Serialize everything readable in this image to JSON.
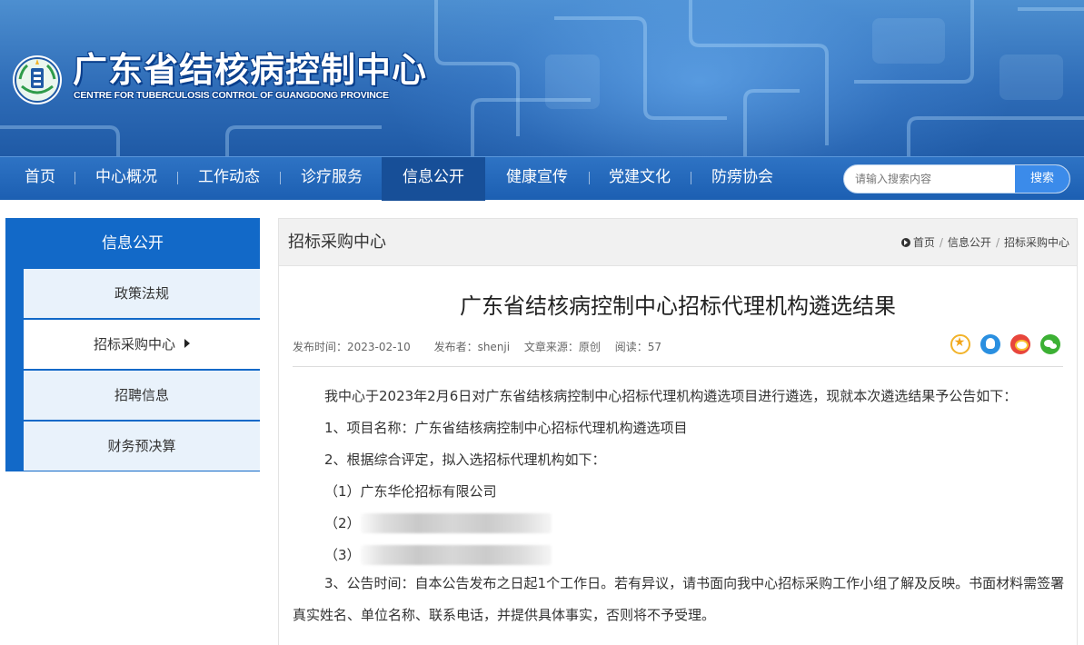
{
  "header": {
    "org_name_cn": "广东省结核病控制中心",
    "org_name_en": "CENTRE FOR TUBERCULOSIS CONTROL OF GUANGDONG PROVINCE",
    "logo_icon": "tb-centre-emblem-icon"
  },
  "nav": {
    "items": [
      {
        "label": "首页"
      },
      {
        "label": "中心概况"
      },
      {
        "label": "工作动态"
      },
      {
        "label": "诊疗服务"
      },
      {
        "label": "信息公开",
        "active": true
      },
      {
        "label": "健康宣传"
      },
      {
        "label": "党建文化"
      },
      {
        "label": "防痨协会"
      }
    ],
    "search_placeholder": "请输入搜索内容",
    "search_button": "搜索"
  },
  "sidebar": {
    "title": "信息公开",
    "items": [
      {
        "label": "政策法规"
      },
      {
        "label": "招标采购中心",
        "active": true
      },
      {
        "label": "招聘信息"
      },
      {
        "label": "财务预决算"
      }
    ]
  },
  "main": {
    "section_title": "招标采购中心",
    "breadcrumb": [
      "首页",
      "信息公开",
      "招标采购中心"
    ],
    "article": {
      "title": "广东省结核病控制中心招标代理机构遴选结果",
      "publish_time": "发布时间：2023-02-10",
      "publisher": "发布者：shenji",
      "source": "文章来源：原创",
      "views": "阅读：57",
      "share_icons": [
        "favorite-star-icon",
        "qq-icon",
        "weibo-icon",
        "wechat-icon"
      ],
      "paragraphs": {
        "p1": "我中心于2023年2月6日对广东省结核病控制中心招标代理机构遴选项目进行遴选，现就本次遴选结果予公告如下：",
        "p2": "1、项目名称：广东省结核病控制中心招标代理机构遴选项目",
        "p3": "2、根据综合评定，拟入选招标代理机构如下：",
        "p4": "（1）广东华伦招标有限公司",
        "p5_prefix": "（2）",
        "p6_prefix": "（3）",
        "p7": "3、公告时间：自本公告发布之日起1个工作日。若有异议，请书面向我中心招标采购工作小组了解及反映。书面材料需签署真实姓名、单位名称、联系电话，并提供具体事实，否则将不予受理。"
      }
    }
  },
  "colors": {
    "nav_blue": "#1c5fb2",
    "sidebar_blue": "#1269c8",
    "search_button": "#3b8bea"
  }
}
